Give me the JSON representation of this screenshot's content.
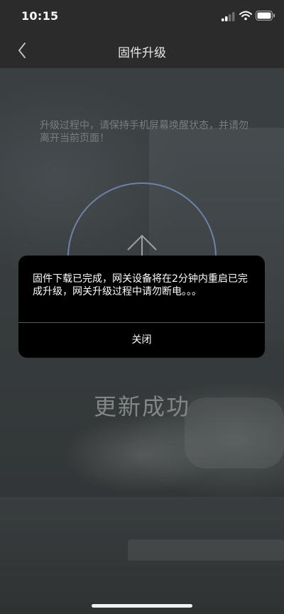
{
  "status_bar": {
    "time": "10:15"
  },
  "nav": {
    "title": "固件升级",
    "back_icon": "chevron-left-icon"
  },
  "hint": {
    "text": "升级过程中，请保持手机屏幕唤醒状态，并请勿离开当前页面！"
  },
  "upgrade": {
    "icon": "arrow-up-icon",
    "status": "更新成功"
  },
  "dialog": {
    "message": "固件下载已完成，网关设备将在2分钟内重启已完成升级，网关升级过程中请勿断电。。。",
    "close_label": "关闭"
  },
  "colors": {
    "bar_background": "#2b2b2b",
    "circle_stroke": "#8ea6d8",
    "dialog_background": "#000000"
  }
}
